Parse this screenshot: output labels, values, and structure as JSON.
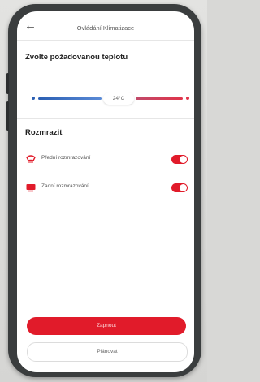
{
  "header": {
    "title": "Ovládání Klimatizace",
    "back_icon": "arrow-left-icon"
  },
  "temperature": {
    "section_title": "Zvolte požadovanou teplotu",
    "value_label": "24°C",
    "min_color": "#2b5fb3",
    "max_color": "#e0344a"
  },
  "defrost": {
    "section_title": "Rozmrazit",
    "items": [
      {
        "label": "Přední rozmrazování",
        "icon": "front-defrost-icon",
        "enabled": true
      },
      {
        "label": "Zadní rozmrazování",
        "icon": "rear-defrost-icon",
        "enabled": true
      }
    ]
  },
  "actions": {
    "primary_label": "Zapnout",
    "secondary_label": "Plánovat"
  },
  "colors": {
    "accent": "#e11b2a",
    "phone_frame": "#3a3d3e"
  }
}
